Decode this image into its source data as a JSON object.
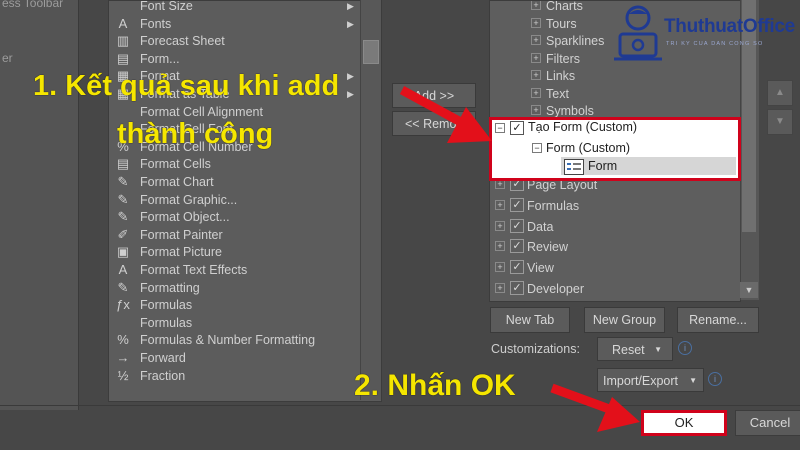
{
  "left_panel": {
    "items": [
      "ess Toolbar",
      "er"
    ]
  },
  "commands": {
    "items": [
      {
        "label": "Font Size",
        "icon": "font-size-icon",
        "glyph": "",
        "has_submenu": true
      },
      {
        "label": "Fonts",
        "icon": "fonts-icon",
        "glyph": "A",
        "has_submenu": true
      },
      {
        "label": "Forecast Sheet",
        "icon": "forecast-sheet-icon",
        "glyph": "▥",
        "has_submenu": false
      },
      {
        "label": "Form...",
        "icon": "form-icon",
        "glyph": "▤",
        "has_submenu": false
      },
      {
        "label": "Format",
        "icon": "format-icon",
        "glyph": "▦",
        "has_submenu": true
      },
      {
        "label": "Format as Table",
        "icon": "format-as-table-icon",
        "glyph": "▦",
        "has_submenu": true
      },
      {
        "label": "Format Cell Alignment",
        "icon": "format-cell-alignment-icon",
        "glyph": "",
        "has_submenu": false
      },
      {
        "label": "Format Cell Font",
        "icon": "format-cell-font-icon",
        "glyph": "",
        "has_submenu": false
      },
      {
        "label": "Format Cell Number",
        "icon": "percent-icon",
        "glyph": "%",
        "has_submenu": false
      },
      {
        "label": "Format Cells",
        "icon": "format-cells-icon",
        "glyph": "▤",
        "has_submenu": false
      },
      {
        "label": "Format Chart",
        "icon": "format-chart-icon",
        "glyph": "✎",
        "has_submenu": false
      },
      {
        "label": "Format Graphic...",
        "icon": "format-graphic-icon",
        "glyph": "✎",
        "has_submenu": false
      },
      {
        "label": "Format Object...",
        "icon": "format-object-icon",
        "glyph": "✎",
        "has_submenu": false
      },
      {
        "label": "Format Painter",
        "icon": "format-painter-icon",
        "glyph": "✐",
        "has_submenu": false
      },
      {
        "label": "Format Picture",
        "icon": "format-picture-icon",
        "glyph": "▣",
        "has_submenu": false
      },
      {
        "label": "Format Text Effects",
        "icon": "text-effects-icon",
        "glyph": "A",
        "has_submenu": false
      },
      {
        "label": "Formatting",
        "icon": "formatting-icon",
        "glyph": "✎",
        "has_submenu": false
      },
      {
        "label": "Formulas",
        "icon": "fx-icon",
        "glyph": "ƒx",
        "has_submenu": false
      },
      {
        "label": "Formulas",
        "icon": "",
        "glyph": "",
        "has_submenu": false
      },
      {
        "label": "Formulas & Number Formatting",
        "icon": "formulas-number-icon",
        "glyph": "%",
        "has_submenu": false
      },
      {
        "label": "Forward",
        "icon": "forward-icon",
        "glyph": "→",
        "has_submenu": false
      },
      {
        "label": "Fraction",
        "icon": "fraction-icon",
        "glyph": "½",
        "has_submenu": false
      }
    ]
  },
  "buttons": {
    "add": "Add >>",
    "remove": "<< Remove"
  },
  "tree": {
    "rows_top": [
      {
        "label": "Charts",
        "checked": false
      },
      {
        "label": "Tours",
        "checked": false
      },
      {
        "label": "Sparklines",
        "checked": false
      },
      {
        "label": "Filters",
        "checked": false
      },
      {
        "label": "Links",
        "checked": false
      },
      {
        "label": "Text",
        "checked": false
      },
      {
        "label": "Symbols",
        "checked": false
      }
    ],
    "custom_tab": "Tạo Form (Custom)",
    "custom_group": "Form (Custom)",
    "custom_item": "Form",
    "rows_bottom": [
      {
        "label": "Page Layout"
      },
      {
        "label": "Formulas"
      },
      {
        "label": "Data"
      },
      {
        "label": "Review"
      },
      {
        "label": "View"
      },
      {
        "label": "Developer"
      }
    ]
  },
  "actions": {
    "new_tab": "New Tab",
    "new_group": "New Group",
    "rename": "Rename...",
    "customizations_label": "Customizations:",
    "reset": "Reset",
    "import_export": "Import/Export"
  },
  "dialog": {
    "ok": "OK",
    "cancel": "Cancel"
  },
  "annotations": {
    "step1_line1": "1. Kết quả sau khi add",
    "step1_line2": "thành công",
    "step2": "2. Nhấn OK"
  },
  "logo": {
    "name": "ThuthuatOffice",
    "tagline": "TRI KY CUA DAN CONG SO"
  },
  "colors": {
    "annotation": "#f5e600",
    "highlight_border": "#d0021b",
    "logo_blue": "#1f3a93"
  }
}
